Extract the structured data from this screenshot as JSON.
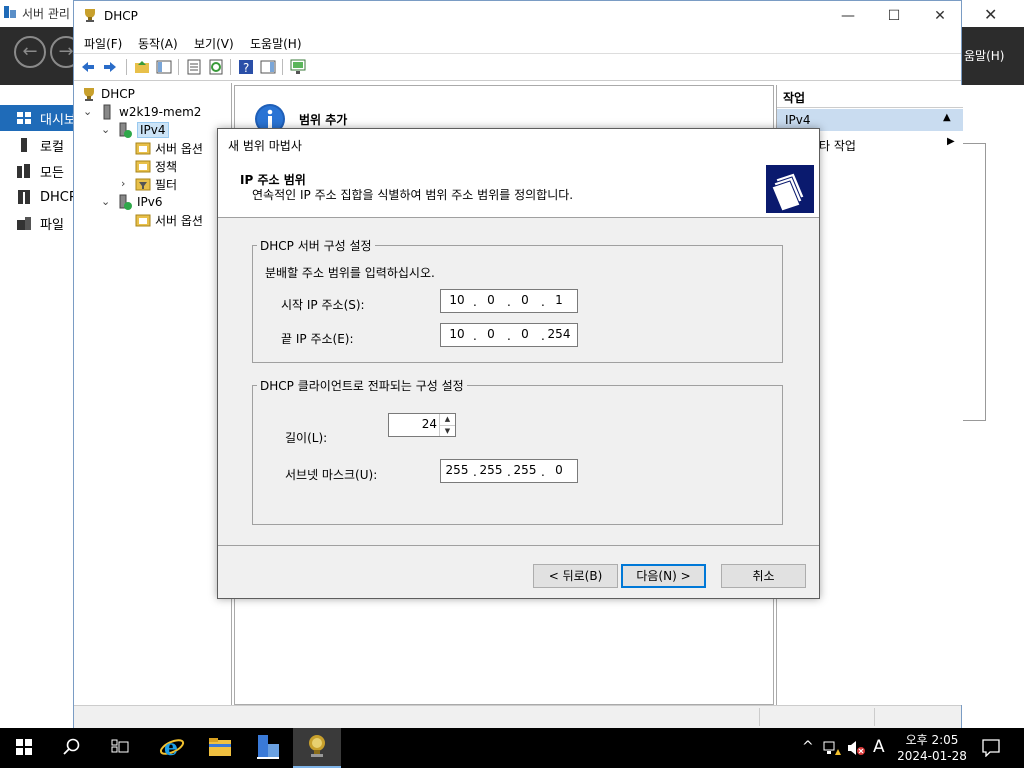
{
  "server_manager": {
    "title": "서버 관리",
    "help_menu": "움말(H)",
    "sidebar": [
      {
        "label": "대시보",
        "icon": "dashboard-icon",
        "active": true
      },
      {
        "label": "로컬",
        "icon": "local-server-icon",
        "active": false
      },
      {
        "label": "모든",
        "icon": "all-servers-icon",
        "active": false
      },
      {
        "label": "DHCP",
        "icon": "dhcp-role-icon",
        "active": false
      },
      {
        "label": "파일",
        "icon": "file-services-icon",
        "active": false
      }
    ]
  },
  "mmc": {
    "title": "DHCP",
    "menu": [
      "파일(F)",
      "동작(A)",
      "보기(V)",
      "도움말(H)"
    ],
    "tree": {
      "root": "DHCP",
      "server": "w2k19-mem2",
      "ipv4": "IPv4",
      "ipv4_children": [
        "서버 옵션",
        "정책",
        "필터"
      ],
      "ipv6": "IPv6",
      "ipv6_children": [
        "서버 옵션"
      ]
    },
    "center_title": "범위 추가",
    "actions": {
      "header": "작업",
      "selected": "IPv4",
      "more": "타 작업"
    }
  },
  "wizard": {
    "title": "새 범위 마법사",
    "heading": "IP 주소 범위",
    "subheading": "연속적인 IP 주소 집합을 식별하여 범위 주소 범위를 정의합니다.",
    "server_group": {
      "legend": "DHCP 서버 구성 설정",
      "instruction": "분배할 주소 범위를 입력하십시오.",
      "start_label": "시작 IP 주소(S):",
      "start_ip": [
        "10",
        "0",
        "0",
        "1"
      ],
      "end_label": "끝 IP 주소(E):",
      "end_ip": [
        "10",
        "0",
        "0",
        "254"
      ]
    },
    "client_group": {
      "legend": "DHCP 클라이언트로 전파되는 구성 설정",
      "length_label": "길이(L):",
      "length_value": "24",
      "mask_label": "서브넷 마스크(U):",
      "mask": [
        "255",
        "255",
        "255",
        "0"
      ]
    },
    "buttons": {
      "back": "< 뒤로(B)",
      "next": "다음(N) >",
      "cancel": "취소"
    }
  },
  "taskbar": {
    "time": "오후 2:05",
    "date": "2024-01-28",
    "ime": "A"
  },
  "colors": {
    "accent": "#0078d7",
    "sidebar_active": "#1f6bb8",
    "nav_bar": "#2c2c2c",
    "banner": "#0a1a6e"
  }
}
